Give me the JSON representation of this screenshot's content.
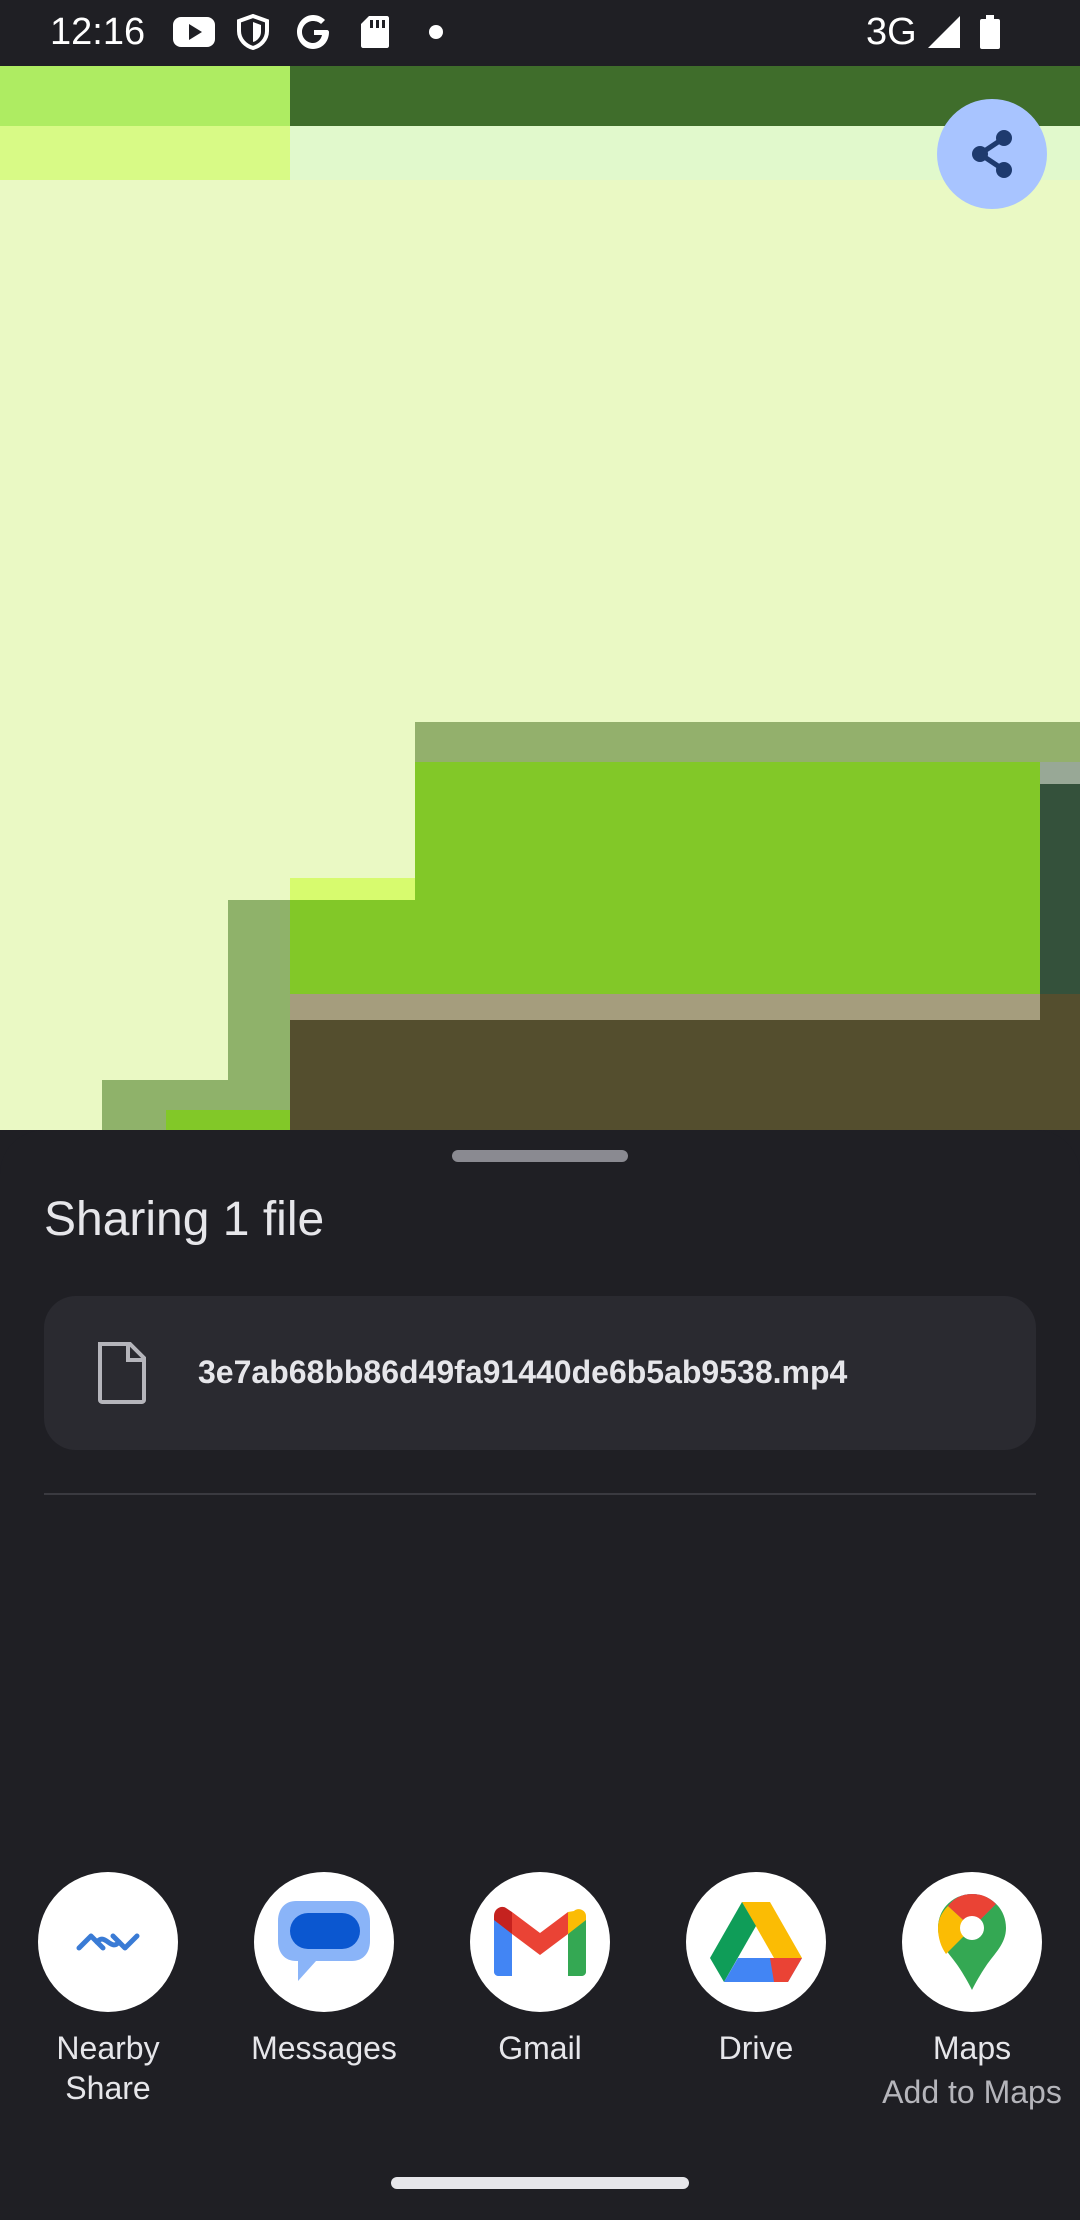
{
  "status_bar": {
    "time": "12:16",
    "network": "3G",
    "icons": [
      "youtube-icon",
      "shield-icon",
      "google-icon",
      "sd-card-icon",
      "notification-dot-icon",
      "signal-icon",
      "battery-icon"
    ]
  },
  "colors": {
    "sheet_bg": "#1f1f24",
    "card_bg": "#2a2a30",
    "fab": "#a8c4ff",
    "art_light": "#eaf9c4",
    "art_green": "#82c828",
    "art_dark": "#544e2e"
  },
  "share_fab": {
    "icon": "share-icon"
  },
  "sheet": {
    "title": "Sharing 1 file",
    "file": {
      "name": "3e7ab68bb86d49fa91440de6b5ab9538.mp4",
      "icon": "file-icon"
    },
    "apps": [
      {
        "label": "Nearby",
        "label2": "Share",
        "icon": "nearby-share-icon"
      },
      {
        "label": "Messages",
        "icon": "messages-icon"
      },
      {
        "label": "Gmail",
        "icon": "gmail-icon"
      },
      {
        "label": "Drive",
        "icon": "drive-icon"
      },
      {
        "label": "Maps",
        "sublabel": "Add to Maps",
        "icon": "maps-icon"
      }
    ]
  }
}
